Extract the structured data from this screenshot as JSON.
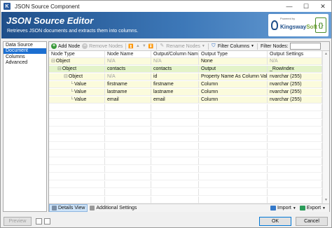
{
  "window": {
    "title": "JSON Source Component",
    "app_icon": "K",
    "minimize": "—",
    "maximize": "☐",
    "close": "✕"
  },
  "header": {
    "title": "JSON Source Editor",
    "subtitle": "Retrieves JSON documents and extracts them into columns.",
    "logo_small": "Powered by",
    "logo_name_a": "Kingsway",
    "logo_name_b": "Soft",
    "logo_badge": "{}"
  },
  "nav": {
    "items": [
      {
        "label": "Data Source",
        "selected": false
      },
      {
        "label": "Document Designer",
        "selected": true
      },
      {
        "label": "Columns",
        "selected": false
      },
      {
        "label": "Advanced",
        "selected": false
      }
    ]
  },
  "toolbar": {
    "add_node": "Add Node",
    "remove_nodes": "Remove Nodes",
    "rename_nodes": "Rename Nodes",
    "filter_columns": "Filter Columns",
    "filter_nodes_label": "Filter Nodes:",
    "filter_nodes_value": ""
  },
  "grid": {
    "headers": [
      "Node Type",
      "Node Name",
      "Output/Column Name",
      "Output Type",
      "Output Settings"
    ],
    "rows": [
      {
        "tree": "⊟",
        "cells": [
          "Object",
          "N/A",
          "N/A",
          "None",
          "N/A"
        ],
        "na": [
          false,
          true,
          true,
          false,
          true
        ],
        "bg": "#fbfbdc",
        "indent": 0
      },
      {
        "tree": "⊟",
        "cells": [
          "Object",
          "contacts",
          "contacts",
          "Output",
          "_RowIndex"
        ],
        "na": [
          false,
          false,
          false,
          false,
          false
        ],
        "bg": "#e3f3c9",
        "indent": 1
      },
      {
        "tree": "⊟",
        "cells": [
          "Object",
          "N/A",
          "id",
          "Property Name As Column Value",
          "nvarchar (255)"
        ],
        "na": [
          false,
          true,
          false,
          false,
          false
        ],
        "bg": "#fbfbdc",
        "indent": 2
      },
      {
        "tree": "",
        "cells": [
          "Value",
          "firstname",
          "firstname",
          "Column",
          "nvarchar (255)"
        ],
        "na": [
          false,
          false,
          false,
          false,
          false
        ],
        "bg": "#fbfbdc",
        "indent": 3
      },
      {
        "tree": "",
        "cells": [
          "Value",
          "lastname",
          "lastname",
          "Column",
          "nvarchar (255)"
        ],
        "na": [
          false,
          false,
          false,
          false,
          false
        ],
        "bg": "#fbfbdc",
        "indent": 3
      },
      {
        "tree": "",
        "cells": [
          "Value",
          "email",
          "email",
          "Column",
          "nvarchar (255)"
        ],
        "na": [
          false,
          false,
          false,
          false,
          false
        ],
        "bg": "#fbfbdc",
        "indent": 3
      }
    ]
  },
  "bottom": {
    "details_view": "Details View",
    "additional_settings": "Additional Settings",
    "import": "Import",
    "export": "Export"
  },
  "footer": {
    "preview": "Preview",
    "ok": "OK",
    "cancel": "Cancel"
  },
  "colors": {
    "accent": "#1c6fd1",
    "header_dark": "#1f4f8a",
    "row_yellow": "#fbfbdc",
    "row_green": "#e3f3c9"
  }
}
